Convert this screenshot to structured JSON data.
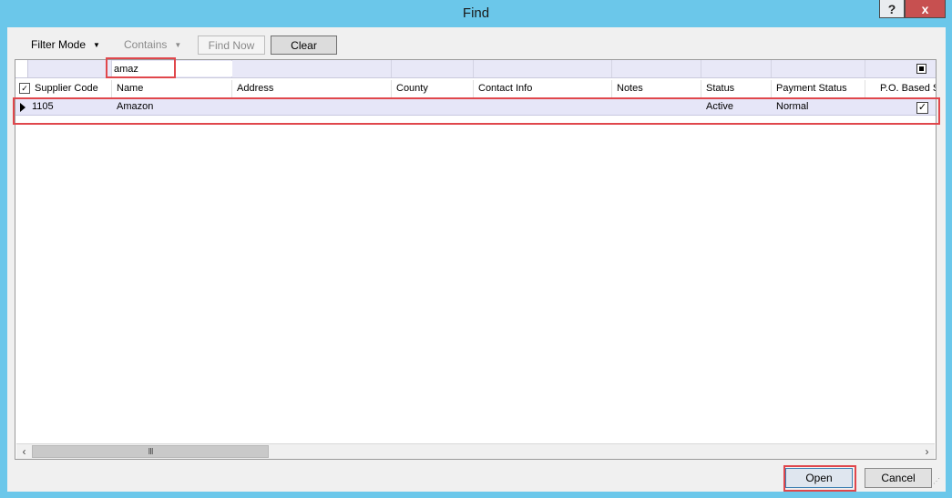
{
  "window": {
    "title": "Find",
    "help_label": "?",
    "close_label": "x"
  },
  "toolbar": {
    "filter_mode_label": "Filter Mode",
    "contains_label": "Contains",
    "find_now_label": "Find Now",
    "clear_label": "Clear"
  },
  "filter": {
    "name_value": "amaz"
  },
  "grid": {
    "columns": [
      "Supplier Code",
      "Name",
      "Address",
      "County",
      "Contact Info",
      "Notes",
      "Status",
      "Payment Status",
      "P.O. Based S"
    ],
    "rows": [
      {
        "supplier_code": "1105",
        "name": "Amazon",
        "address": "",
        "county": "",
        "contact_info": "",
        "notes": "",
        "status": "Active",
        "payment_status": "Normal",
        "po_based": true
      }
    ]
  },
  "scrollbar": {
    "thumb_label": "III"
  },
  "footer": {
    "open_label": "Open",
    "cancel_label": "Cancel"
  },
  "colors": {
    "window_frame": "#6bc7ea",
    "highlight": "#e0474c",
    "selected_row": "#e6e6f8",
    "close_button": "#c75050"
  }
}
